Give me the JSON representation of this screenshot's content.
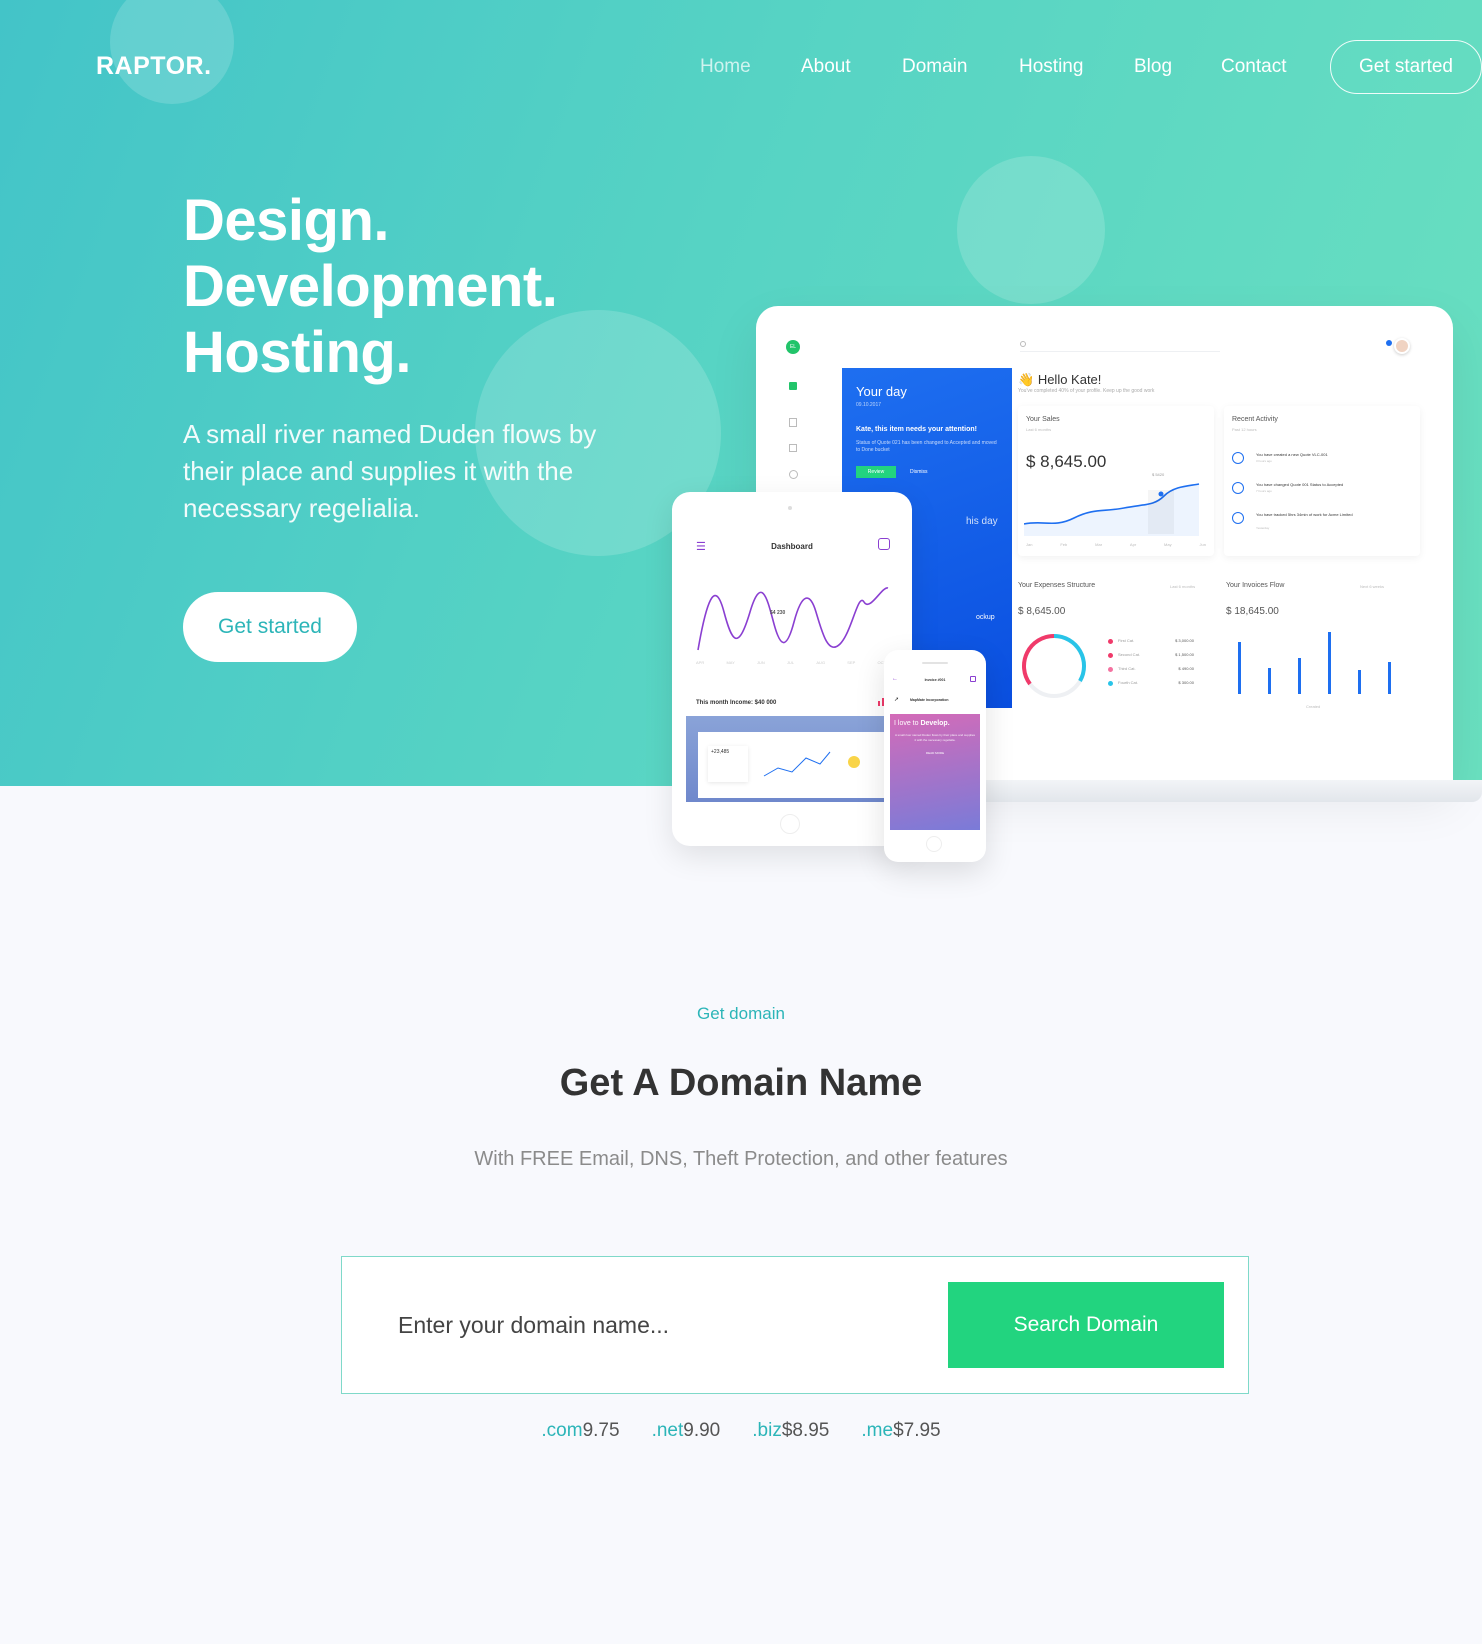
{
  "brand": {
    "name": "RAPTOR."
  },
  "nav": {
    "items": [
      {
        "label": "Home"
      },
      {
        "label": "About"
      },
      {
        "label": "Domain"
      },
      {
        "label": "Hosting"
      },
      {
        "label": "Blog"
      },
      {
        "label": "Contact"
      }
    ],
    "cta_label": "Get started"
  },
  "hero": {
    "headline": [
      "Design.",
      "Development.",
      "Hosting."
    ],
    "lead": "A small river named Duden flows by their place and supplies it with the necessary regelialia.",
    "cta_label": "Get started"
  },
  "mockup": {
    "panel_title": "Your day",
    "panel_date": "09.10.2017",
    "panel_alert": "Kate, this item needs your attention!",
    "panel_alert_sub": "Status of Quote 021 has been changed to Accepted and moved to Done bucket",
    "review_label": "Review",
    "dismiss_label": "Dismiss",
    "this_day": "his day",
    "mockup_word": "ockup",
    "greeting": "Hello Kate!",
    "greeting_sub": "You've completed 40% of your profile. Keep up the good work",
    "sales_title": "Your Sales",
    "sales_period": "Last 6 months",
    "sales_value": "$ 8,645.00",
    "sales_point": "$ 5420",
    "months": [
      "Jan",
      "Feb",
      "Mar",
      "Apr",
      "May",
      "Jun"
    ],
    "activity_title": "Recent Activity",
    "activity_period": "Past 12 hours",
    "activities": [
      {
        "text": "You have created a new Quote VLC-001",
        "time": "3 hours ago"
      },
      {
        "text": "You have changed Quote 001 Status to Accepted",
        "time": "7 hours ago"
      },
      {
        "text": "You have tracked 5hrs 34min of work for Acme Limited",
        "time": "Yesterday"
      }
    ],
    "expenses_title": "Your Expenses Structure",
    "expenses_period": "Last 6 months",
    "expenses_value": "$ 8,645.00",
    "expenses": [
      {
        "label": "First Cat.",
        "value": "$ 3,000.00",
        "color": "#f03a6a"
      },
      {
        "label": "Second Cat.",
        "value": "$ 1,500.00",
        "color": "#f03a6a"
      },
      {
        "label": "Third Cat.",
        "value": "$ 490.00",
        "color": "#f472a0"
      },
      {
        "label": "Fourth Cat.",
        "value": "$ 300.00",
        "color": "#29c4e8"
      }
    ],
    "invoices_title": "Your Invoices Flow",
    "invoices_period": "Next 6 weeks",
    "invoices_value": "$ 18,645.00",
    "invoices_foot": [
      "Created"
    ],
    "tablet_title": "Dashboard",
    "tablet_point": "$4 230",
    "tablet_months": [
      "APR",
      "MAY",
      "JUN",
      "JUL",
      "AUG",
      "SEP",
      "OCT"
    ],
    "tablet_income": "This month Income: $40 000",
    "tablet_stat": "+23,485",
    "phone_title": "Invoice #001",
    "phone_item": "MapMate Incorporation",
    "phone_love": "I love to",
    "phone_develop": "Develop.",
    "phone_body": "A small river named Duden flows by their place and supplies it with the necessary regelialia.",
    "phone_read": "READ MORE"
  },
  "domain": {
    "eyebrow": "Get domain",
    "title": "Get A Domain Name",
    "subtitle": "With FREE Email, DNS, Theft Protection, and other features",
    "input_placeholder": "Enter your domain name...",
    "search_label": "Search Domain",
    "prices": [
      {
        "ext": ".com",
        "price": "9.75"
      },
      {
        "ext": ".net",
        "price": "9.90"
      },
      {
        "ext": ".biz",
        "price": "$8.95"
      },
      {
        "ext": ".me",
        "price": "$7.95"
      }
    ]
  },
  "colors": {
    "accent": "#2cb5b8",
    "search_button": "#22d47f",
    "panel_blue": "#1e6ff0"
  }
}
